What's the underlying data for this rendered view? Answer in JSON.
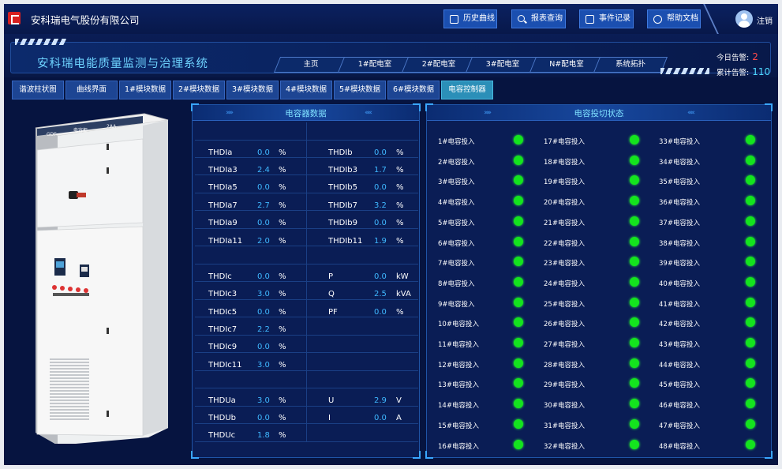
{
  "company": "安科瑞电气股份有限公司",
  "system_title": "安科瑞电能质量监测与治理系统",
  "top_buttons": [
    {
      "label": "历史曲线",
      "icon": "chart-icon"
    },
    {
      "label": "报表查询",
      "icon": "search-icon"
    },
    {
      "label": "事件记录",
      "icon": "document-icon"
    },
    {
      "label": "帮助文档",
      "icon": "help-icon"
    }
  ],
  "user": {
    "logout_label": "注销"
  },
  "nav_tabs": [
    "主页",
    "1#配电室",
    "2#配电室",
    "3#配电室",
    "N#配电室",
    "系统拓扑"
  ],
  "alarms": {
    "today_label": "今日告警:",
    "today_value": "2",
    "total_label": "累计告警:",
    "total_value": "110"
  },
  "sub_tabs": [
    "谐波柱状图",
    "曲线界面",
    "1#模块数据",
    "2#模块数据",
    "3#模块数据",
    "4#模块数据",
    "5#模块数据",
    "6#模块数据",
    "电容控制器"
  ],
  "active_sub_tab": "电容控制器",
  "cabinet": {
    "brand": "GDF",
    "name": "电容柜",
    "code": "2AA"
  },
  "capacitor_data": {
    "title": "电容器数据",
    "left": [
      {
        "label": "THDIa",
        "value": "0.0",
        "unit": "%"
      },
      {
        "label": "THDIa3",
        "value": "2.4",
        "unit": "%"
      },
      {
        "label": "THDIa5",
        "value": "0.0",
        "unit": "%"
      },
      {
        "label": "THDIa7",
        "value": "2.7",
        "unit": "%"
      },
      {
        "label": "THDIa9",
        "value": "0.0",
        "unit": "%"
      },
      {
        "label": "THDIa11",
        "value": "2.0",
        "unit": "%"
      },
      {
        "label": "THDIc",
        "value": "0.0",
        "unit": "%"
      },
      {
        "label": "THDIc3",
        "value": "3.0",
        "unit": "%"
      },
      {
        "label": "THDIc5",
        "value": "0.0",
        "unit": "%"
      },
      {
        "label": "THDIc7",
        "value": "2.2",
        "unit": "%"
      },
      {
        "label": "THDIc9",
        "value": "0.0",
        "unit": "%"
      },
      {
        "label": "THDIc11",
        "value": "3.0",
        "unit": "%"
      },
      {
        "label": "THDUa",
        "value": "3.0",
        "unit": "%"
      },
      {
        "label": "THDUb",
        "value": "0.0",
        "unit": "%"
      },
      {
        "label": "THDUc",
        "value": "1.8",
        "unit": "%"
      }
    ],
    "right": [
      {
        "label": "THDIb",
        "value": "0.0",
        "unit": "%"
      },
      {
        "label": "THDIb3",
        "value": "1.7",
        "unit": "%"
      },
      {
        "label": "THDIb5",
        "value": "0.0",
        "unit": "%"
      },
      {
        "label": "THDIb7",
        "value": "3.2",
        "unit": "%"
      },
      {
        "label": "THDIb9",
        "value": "0.0",
        "unit": "%"
      },
      {
        "label": "THDIb11",
        "value": "1.9",
        "unit": "%"
      },
      {
        "label": "P",
        "value": "0.0",
        "unit": "kW"
      },
      {
        "label": "Q",
        "value": "2.5",
        "unit": "kVA"
      },
      {
        "label": "PF",
        "value": "0.0",
        "unit": "%"
      },
      {
        "label": "U",
        "value": "2.9",
        "unit": "V"
      },
      {
        "label": "I",
        "value": "0.0",
        "unit": "A"
      }
    ]
  },
  "switch_status": {
    "title": "电容投切状态",
    "item_suffix": "#电容投入",
    "count": 48,
    "per_column": 16,
    "on_color": "#14e41e",
    "states": [
      "on",
      "on",
      "on",
      "on",
      "on",
      "on",
      "on",
      "on",
      "on",
      "on",
      "on",
      "on",
      "on",
      "on",
      "on",
      "on",
      "on",
      "on",
      "on",
      "on",
      "on",
      "on",
      "on",
      "on",
      "on",
      "on",
      "on",
      "on",
      "on",
      "on",
      "on",
      "on",
      "on",
      "on",
      "on",
      "on",
      "on",
      "on",
      "on",
      "on",
      "on",
      "on",
      "on",
      "on",
      "on",
      "on",
      "on",
      "on"
    ]
  }
}
